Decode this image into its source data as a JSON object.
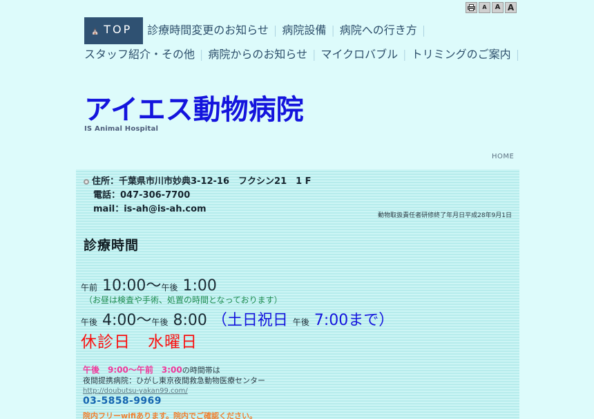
{
  "utility_bar": {
    "print_icon": "printer-icon",
    "font_sizes": [
      {
        "label": "A",
        "name": "font-size-small"
      },
      {
        "label": "A",
        "name": "font-size-medium"
      },
      {
        "label": "A",
        "name": "font-size-large"
      }
    ]
  },
  "nav": {
    "top_label": "TOP",
    "home_icon": "home-icon",
    "separator": "|",
    "items": [
      "診療時間変更のお知らせ",
      "病院設備",
      "病院への行き方",
      "スタッフ紹介・その他",
      "病院からのお知らせ",
      "マイクロバブル",
      "トリミングのご案内"
    ]
  },
  "site": {
    "title": "アイエス動物病院",
    "subtitle": "IS Animal Hospital",
    "title_color": "#1414dd"
  },
  "breadcrumb": {
    "home": "HOME"
  },
  "contact": {
    "address": "住所：千葉県市川市妙典3-12-16　フクシン21　1 F",
    "phone": "電話：047-306-7700",
    "mail": "mail：is-ah@is-ah.com",
    "license_note": "動物取扱責任者研修終了年月日平成28年9月1日"
  },
  "hours": {
    "heading": "診療時間",
    "morning_prefix": "午前",
    "morning_start": "10:00",
    "tilde": "〜",
    "morning_suffix_label": "午後",
    "morning_end": "1:00",
    "lunch_note": "（お昼は検査や手術、処置の時間となっております）",
    "afternoon_prefix": "午後",
    "afternoon_start": "4:00",
    "afternoon_suffix_label": "午後",
    "afternoon_end": "8:00",
    "weekend_open": "（土日祝日",
    "weekend_label": "午後",
    "weekend_end": "7:00まで）",
    "closed_label": "休診日",
    "closed_day": "水曜日",
    "closed_color": "#fb1010",
    "weekend_color": "#1414dd",
    "note_color": "#1d8a4e"
  },
  "night": {
    "hours_range": "午後　9:00〜午前　3:00",
    "hours_suffix": "の時間帯は",
    "partner_label": "夜間提携病院：ひがし東京夜間救急動物医療センター",
    "url": "http://doubutsu-yakan99.com/",
    "tel": "03-5858-9969",
    "hours_color": "#f0379a",
    "tel_color": "#1565b0"
  },
  "wifi": {
    "note": "院内フリーwifiあります。院内でご確認ください。",
    "color": "#f08030"
  }
}
